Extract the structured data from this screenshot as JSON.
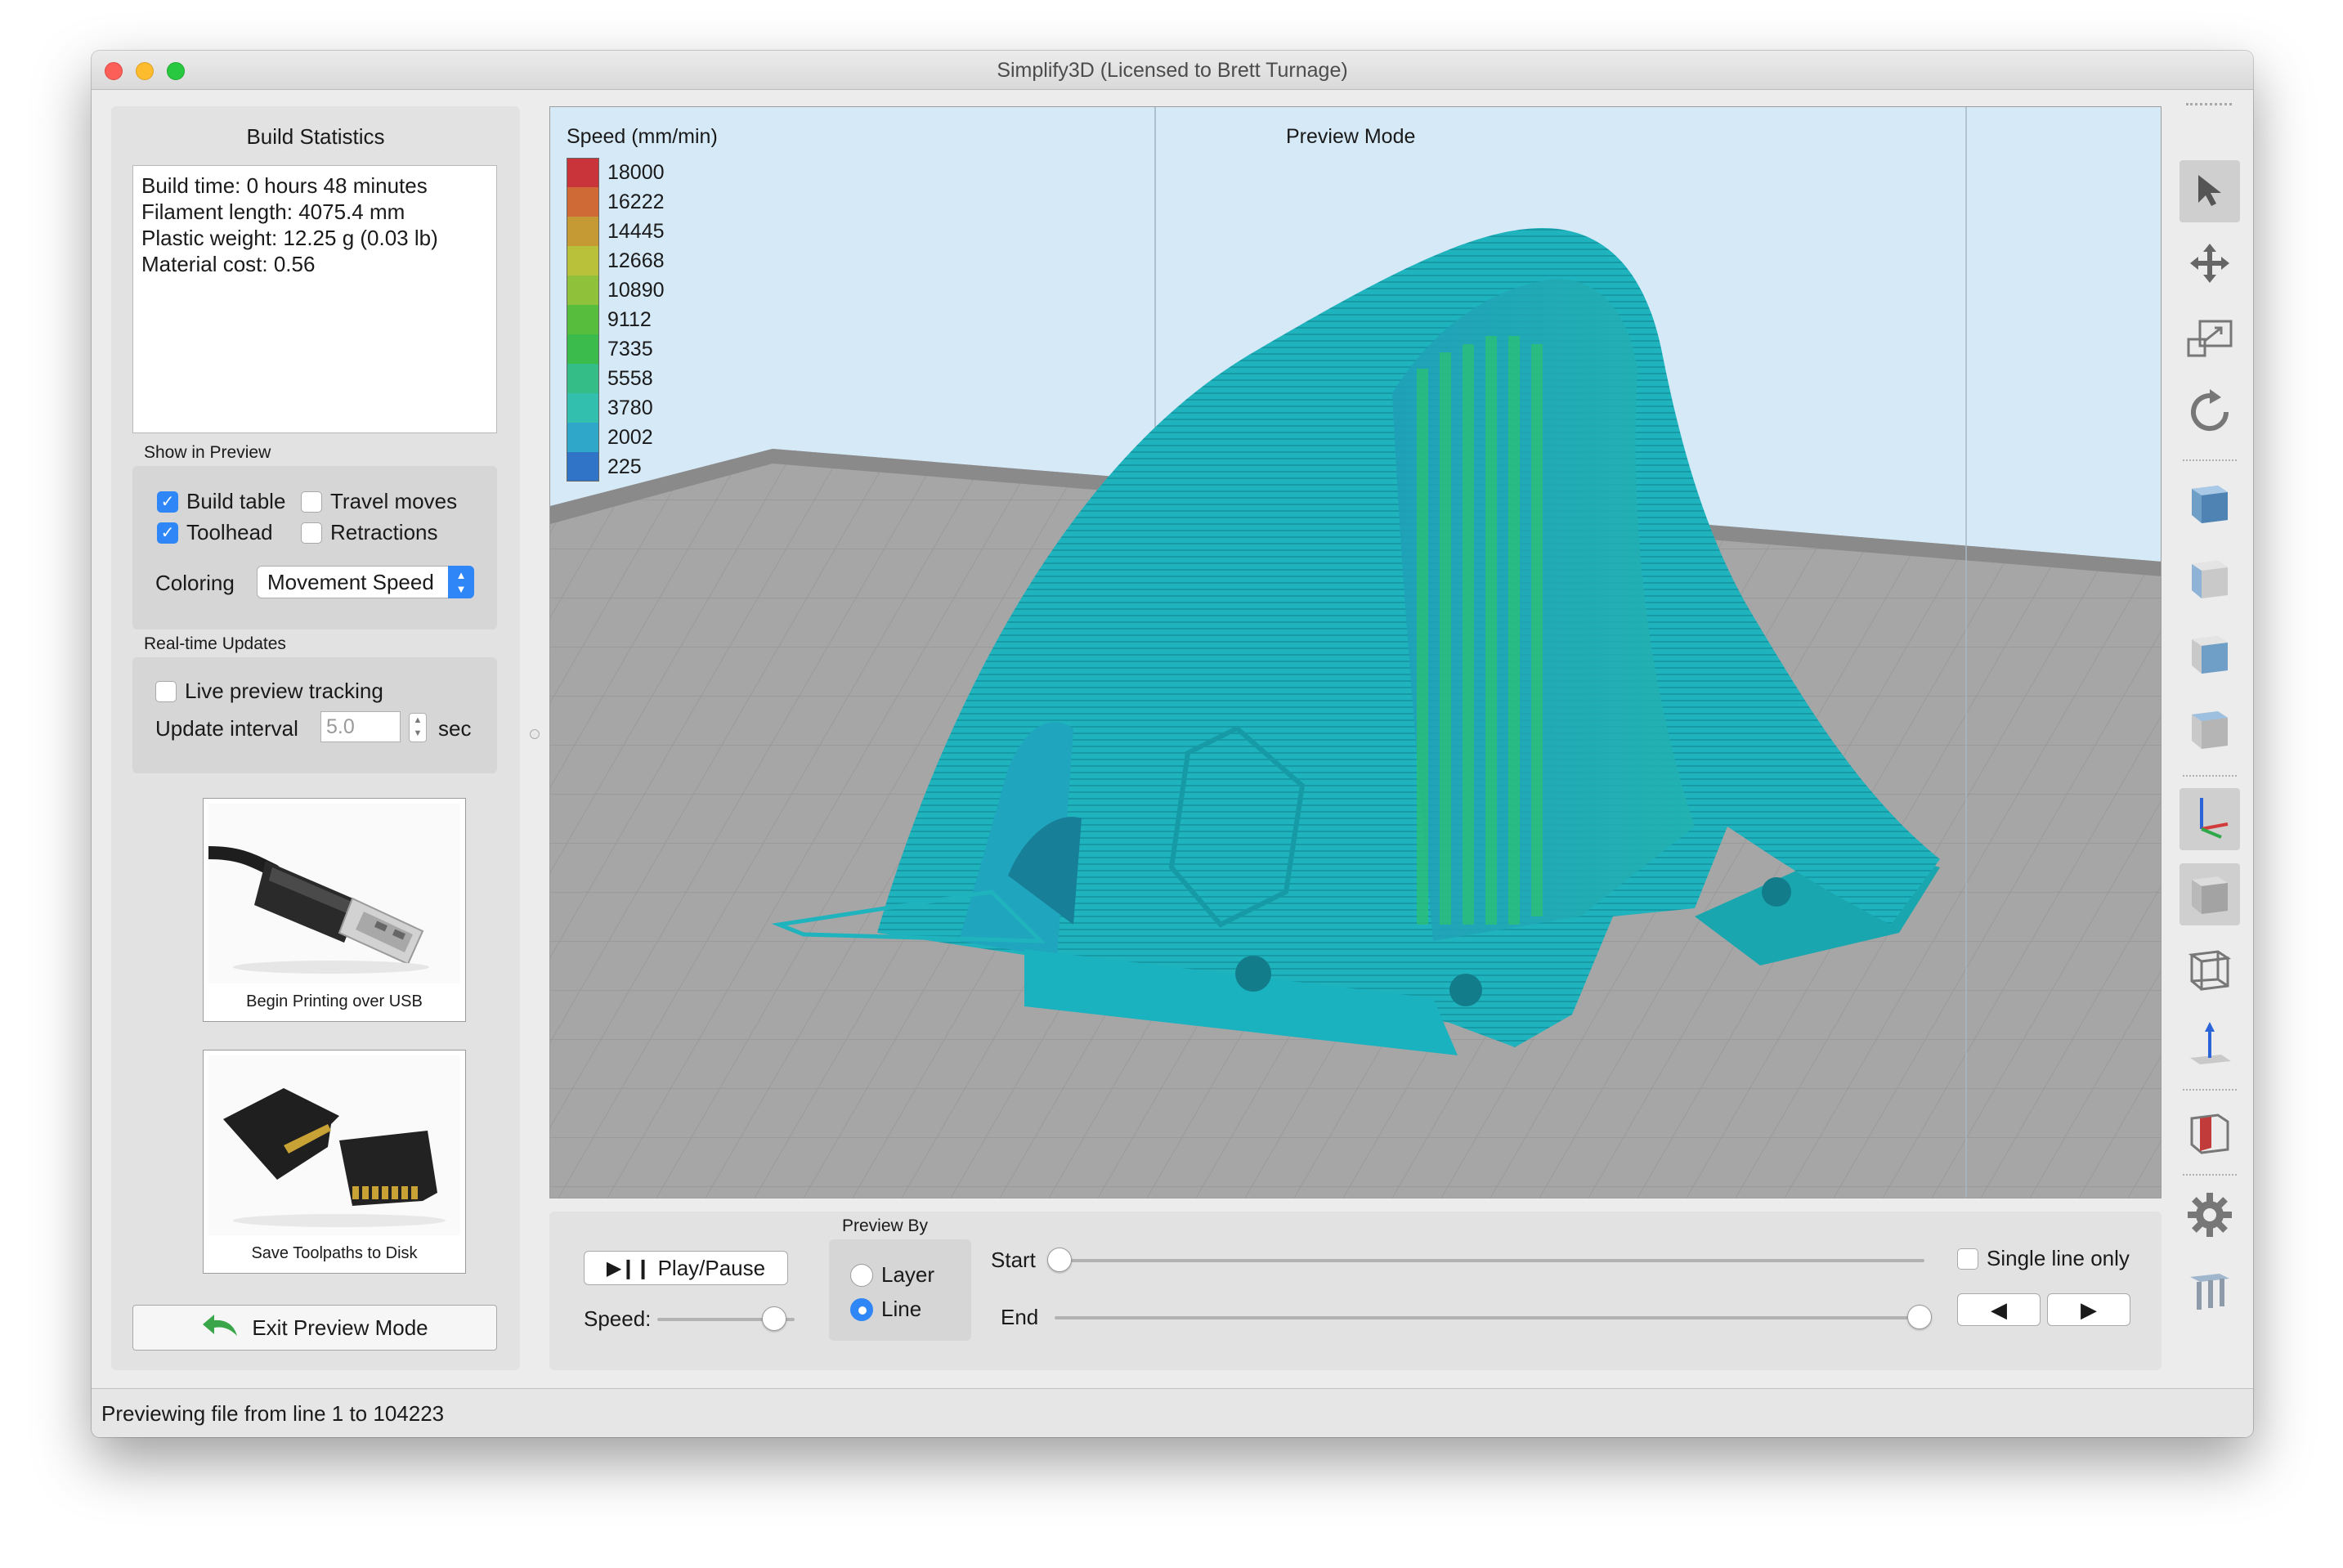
{
  "window": {
    "title": "Simplify3D (Licensed to Brett Turnage)"
  },
  "build_statistics": {
    "title": "Build Statistics",
    "lines": [
      "Build time: 0 hours 48 minutes",
      "Filament length: 4075.4 mm",
      "Plastic weight: 12.25 g (0.03 lb)",
      "Material cost: 0.56"
    ]
  },
  "show_in_preview": {
    "label": "Show in Preview",
    "build_table": {
      "label": "Build table",
      "checked": true
    },
    "travel_moves": {
      "label": "Travel moves",
      "checked": false
    },
    "toolhead": {
      "label": "Toolhead",
      "checked": true
    },
    "retractions": {
      "label": "Retractions",
      "checked": false
    },
    "coloring_label": "Coloring",
    "coloring_value": "Movement Speed"
  },
  "realtime_updates": {
    "label": "Real-time Updates",
    "live_tracking": {
      "label": "Live preview tracking",
      "checked": false
    },
    "interval_label": "Update interval",
    "interval_value": "5.0",
    "interval_unit": "sec"
  },
  "actions": {
    "usb_label": "Begin Printing over USB",
    "disk_label": "Save Toolpaths to Disk",
    "exit_label": "Exit Preview Mode"
  },
  "viewport": {
    "legend_title": "Speed (mm/min)",
    "mode_label": "Preview Mode",
    "legend": [
      {
        "value": "18000",
        "color": "#c8343a"
      },
      {
        "value": "16222",
        "color": "#cf6a36"
      },
      {
        "value": "14445",
        "color": "#c59a34"
      },
      {
        "value": "12668",
        "color": "#b9c13a"
      },
      {
        "value": "10890",
        "color": "#8fc13a"
      },
      {
        "value": "9112",
        "color": "#57bd3c"
      },
      {
        "value": "7335",
        "color": "#3bbb4c"
      },
      {
        "value": "5558",
        "color": "#35bd88"
      },
      {
        "value": "3780",
        "color": "#33bfae"
      },
      {
        "value": "2002",
        "color": "#2fa7c8"
      },
      {
        "value": "225",
        "color": "#2f74c6"
      }
    ],
    "model_color": "#1fb3bd"
  },
  "playback": {
    "play_label": "Play/Pause",
    "speed_label": "Speed:",
    "speed_fraction": 0.85,
    "preview_by_label": "Preview By",
    "layer_label": "Layer",
    "line_label": "Line",
    "selected": "Line",
    "start_label": "Start",
    "end_label": "End",
    "start_fraction": 0.0,
    "end_fraction": 1.0,
    "single_line_label": "Single line only",
    "single_line_checked": false,
    "prev_glyph": "◀",
    "next_glyph": "▶"
  },
  "status": {
    "text": "Previewing file from line 1 to 104223"
  },
  "colors": {
    "accent": "#2f86f6"
  }
}
